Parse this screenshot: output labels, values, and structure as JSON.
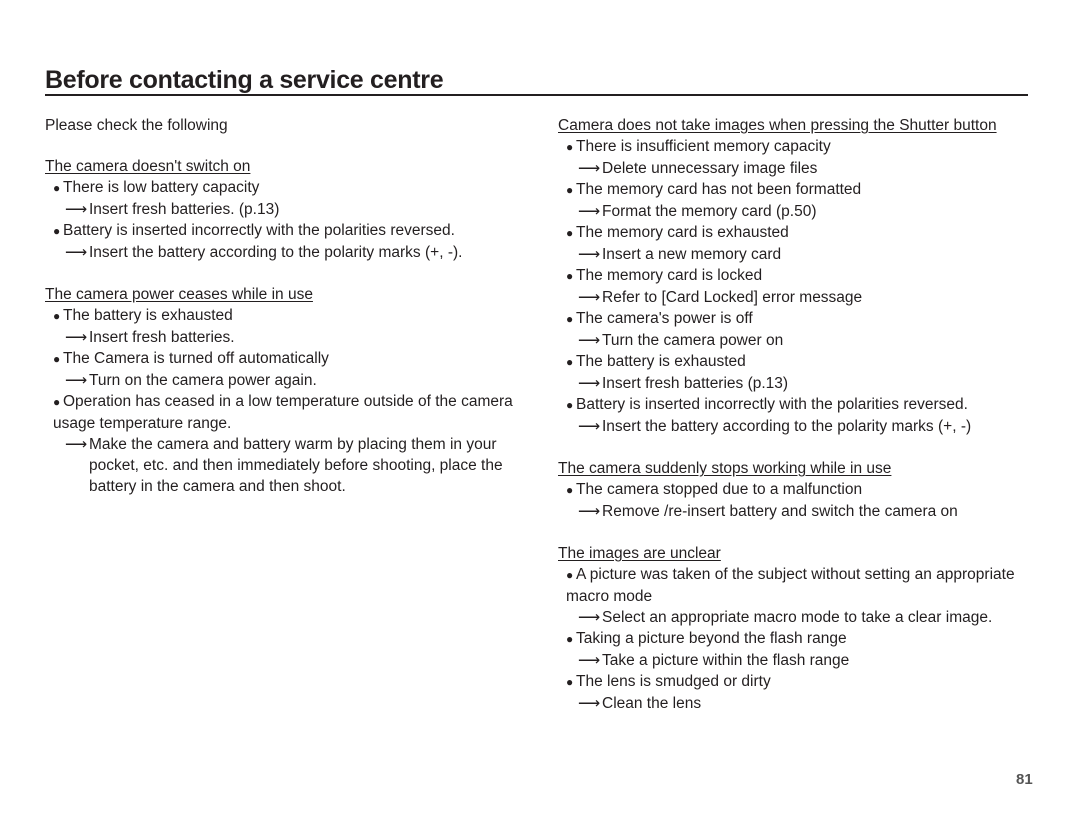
{
  "page": {
    "title": "Before contacting a service centre",
    "intro": "Please check the following",
    "page_number": "81",
    "icons": {
      "bullet": "●",
      "arrow": "⟶"
    }
  },
  "left_sections": [
    {
      "heading": "The camera doesn't switch on",
      "items": [
        {
          "cause": "There is low battery capacity",
          "remedy": "Insert fresh batteries. (p.13)"
        },
        {
          "cause": "Battery is inserted incorrectly with the polarities reversed.",
          "remedy": "Insert the battery according to the polarity marks (+, -)."
        }
      ]
    },
    {
      "heading": "The camera power ceases while in use",
      "items": [
        {
          "cause": "The battery is exhausted",
          "remedy": "Insert fresh batteries."
        },
        {
          "cause": "The Camera is turned off automatically",
          "remedy": "Turn on the camera power again."
        },
        {
          "cause": "Operation has ceased in a low temperature outside of the camera usage temperature range.",
          "remedy": "Make the camera and battery warm by placing them in your pocket, etc. and then immediately before shooting, place the battery in the camera and then shoot."
        }
      ]
    }
  ],
  "right_sections": [
    {
      "heading": "Camera does not take images when pressing the Shutter button",
      "items": [
        {
          "cause": "There is insufficient memory capacity",
          "remedy": "Delete unnecessary image files"
        },
        {
          "cause": "The memory card has not been formatted",
          "remedy": "Format the memory card (p.50)"
        },
        {
          "cause": "The memory card is exhausted",
          "remedy": "Insert a new memory card"
        },
        {
          "cause": "The memory card is locked",
          "remedy": "Refer to [Card Locked] error message"
        },
        {
          "cause": "The camera's power is off",
          "remedy": "Turn the camera power on"
        },
        {
          "cause": "The battery is exhausted",
          "remedy": "Insert fresh batteries (p.13)"
        },
        {
          "cause": "Battery is inserted incorrectly with the polarities reversed.",
          "remedy": "Insert the battery according to the polarity marks (+, -)"
        }
      ]
    },
    {
      "heading": "The camera suddenly stops working while in use",
      "items": [
        {
          "cause": "The camera stopped due to a malfunction",
          "remedy": "Remove /re-insert battery and switch the camera on"
        }
      ]
    },
    {
      "heading": "The images are unclear",
      "items": [
        {
          "cause": "A picture was taken of the subject without setting an appropriate macro mode",
          "remedy": "Select an appropriate macro mode to take a clear image."
        },
        {
          "cause": "Taking a picture beyond the flash range",
          "remedy": "Take a picture within the flash range"
        },
        {
          "cause": "The lens is smudged or dirty",
          "remedy": "Clean the lens"
        }
      ]
    }
  ]
}
